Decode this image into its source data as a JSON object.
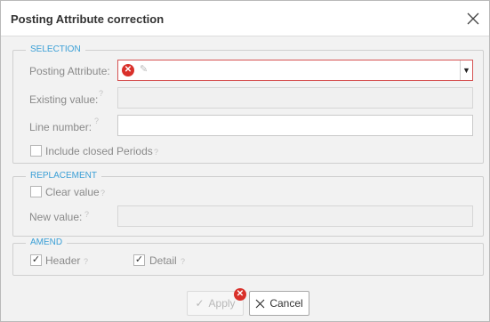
{
  "dialog": {
    "title": "Posting Attribute correction"
  },
  "selection": {
    "legend": "SELECTION",
    "posting_attribute_label": "Posting Attribute:",
    "existing_value_label": "Existing value:",
    "line_number_label": "Line number:",
    "line_number_value": "",
    "include_closed_label": "Include closed Periods",
    "include_closed_checked": false
  },
  "replacement": {
    "legend": "REPLACEMENT",
    "clear_value_label": "Clear value",
    "clear_value_checked": false,
    "new_value_label": "New value:"
  },
  "amend": {
    "legend": "AMEND",
    "header_label": "Header",
    "header_checked": true,
    "detail_label": "Detail",
    "detail_checked": true
  },
  "buttons": {
    "apply_label": "Apply",
    "cancel_label": "Cancel"
  },
  "help_glyph": "?",
  "colors": {
    "accent": "#3a9fd6",
    "error": "#d9302a"
  }
}
